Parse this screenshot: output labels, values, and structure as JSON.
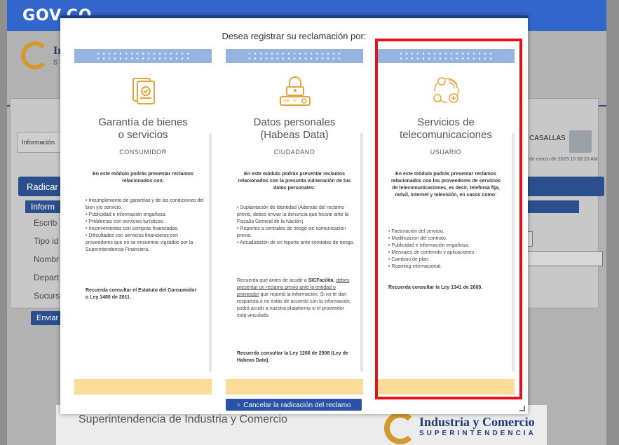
{
  "background": {
    "gov_logo": "GOV.CO",
    "logo_text": "In",
    "logo_sub": "SU",
    "info_tab": "Información",
    "user_name": "CASALLAS",
    "date_text": "de marzo de 2023 10:58:20 AM",
    "radicar_label": "Radicar",
    "inform_label": "Inform",
    "fields": [
      "Escrib",
      "Tipo id",
      "Nombr",
      "Depart",
      "Sucurs"
    ],
    "enviar_label": "Enviar",
    "footer_title": "Superintendencia de Industria y Comercio",
    "footer_logo": "Industria y Comercio",
    "footer_sub": "SUPERINTENDENCIA"
  },
  "modal": {
    "title": "Desea registrar su reclamación por:",
    "cancel_label": "Cancelar la radicación del reclamo",
    "columns": [
      {
        "icon": "document-check-icon",
        "title_line1": "Garantía de bienes",
        "title_line2": "o servicios",
        "role": "CONSUMIDOR",
        "intro": "En este módulo podrás presentar reclamos relacionados con:",
        "items": [
          "Incumplimiento de garantías y de las condiciones del bien y/o servicio.",
          "Publicidad e información engañosa.",
          "Problemas con servicios turísticos.",
          "Inconvenientes con compras financiadas.",
          "Dificultades con servicios financieros con proveedores que no se encuentre vigilados por la Superintendencia Financiera."
        ],
        "reference": "Recuerda consultar el Estatuto del Consumidor o Ley 1480 de 2011."
      },
      {
        "icon": "lock-icon",
        "title_line1": "Datos personales",
        "title_line2": "(Habeas Data)",
        "role": "CIUDADANO",
        "intro": "En este módulo podrás presentar reclamos relacionados con la presunta vulneración de tus datos personales:",
        "items": [
          "Suplantación de identidad (Además del reclamo previo, debes enviar la denuncia que hiciste ante la Fiscalía General de la Nación)",
          "Reportes a centrales de riesgo sin comunicación previa.",
          "Actualización de un reporte ante centrales de riesgo."
        ],
        "note_prefix": "Recuerda que antes de acudir a",
        "note_bold": "SICFacilita",
        "note_link": "debes presentar un reclamo previo ante la entidad o proveedor",
        "note_suffix": "que reportó la información. Si no te dan respuesta o no estás de acuerdo con la información, podrá acudir a nuestra plataforma si el proveedor está vinculado.",
        "reference": "Recuerda consultar la Ley 1266 de 2008 (Ley de Habeas Data)."
      },
      {
        "icon": "telecom-services-icon",
        "title_line1": "Servicios de",
        "title_line2": "telecomunicaciones",
        "role": "USUARIO",
        "intro": "En este módulo podrás presentar reclamos relacionados con los proveedores de servicios de telecomunicaciones, es decir, telefonía fija, móvil, internet y televisión, en casos como:",
        "items": [
          "Facturación del servicio.",
          "Modificación del contrato.",
          "Publicidad e información engañosa.",
          "Mensajes de contenido y aplicaciones.",
          "Cambios de plan.",
          "Roaming internacional."
        ],
        "reference": "Recuerda consultar la Ley 1341 de 2009."
      }
    ]
  },
  "colors": {
    "accent_blue": "#2a52a6",
    "header_blue": "#96b4e2",
    "footer_yellow": "#fbdd99",
    "icon_orange": "#e8a33d",
    "highlight_red": "#e8131a"
  }
}
